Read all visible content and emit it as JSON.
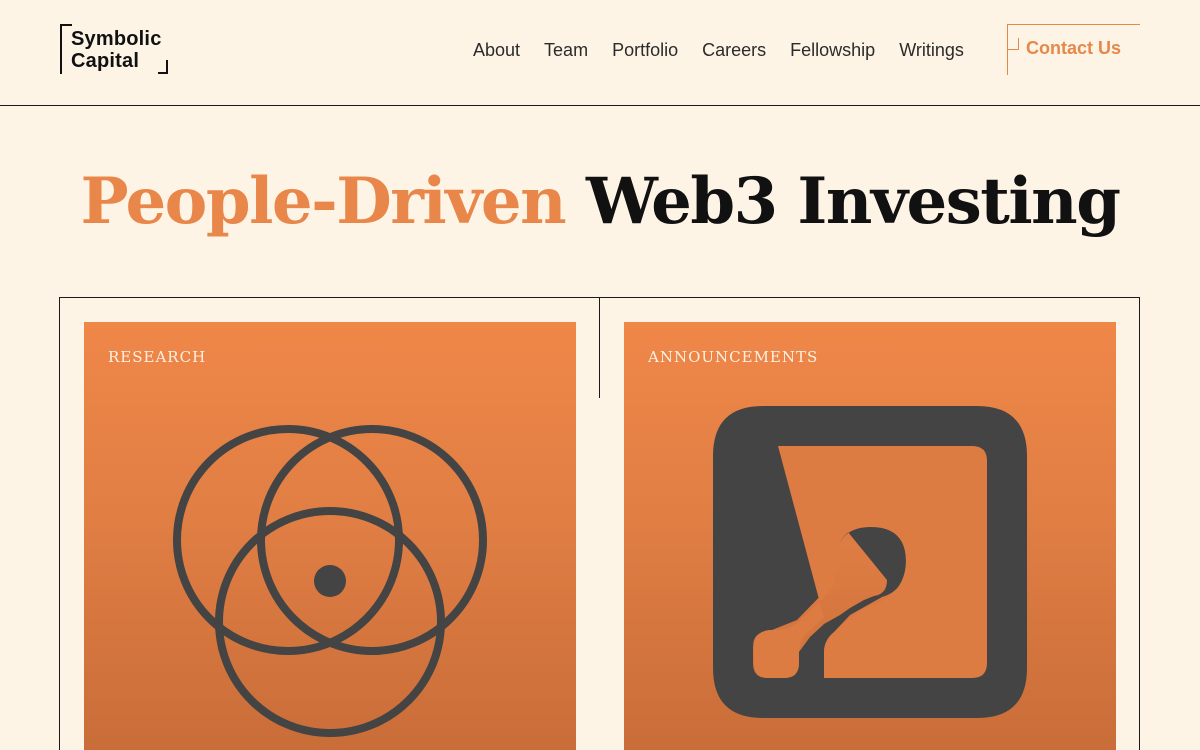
{
  "header": {
    "logo": {
      "line1": "Symbolic",
      "line2": "Capital"
    },
    "nav": [
      "About",
      "Team",
      "Portfolio",
      "Careers",
      "Fellowship",
      "Writings"
    ],
    "contact_label": "Contact Us"
  },
  "hero": {
    "accent_text": "People-Driven",
    "dark_text": "Web3 Investing"
  },
  "cards": [
    {
      "label": "RESEARCH",
      "icon": "venn-circles-icon"
    },
    {
      "label": "ANNOUNCEMENTS",
      "icon": "key-square-icon"
    }
  ],
  "colors": {
    "background": "#fdf4e6",
    "accent": "#e9874b",
    "text": "#111111",
    "card_top": "#ef8748",
    "card_bottom": "#c86c38",
    "icon": "#444444"
  }
}
